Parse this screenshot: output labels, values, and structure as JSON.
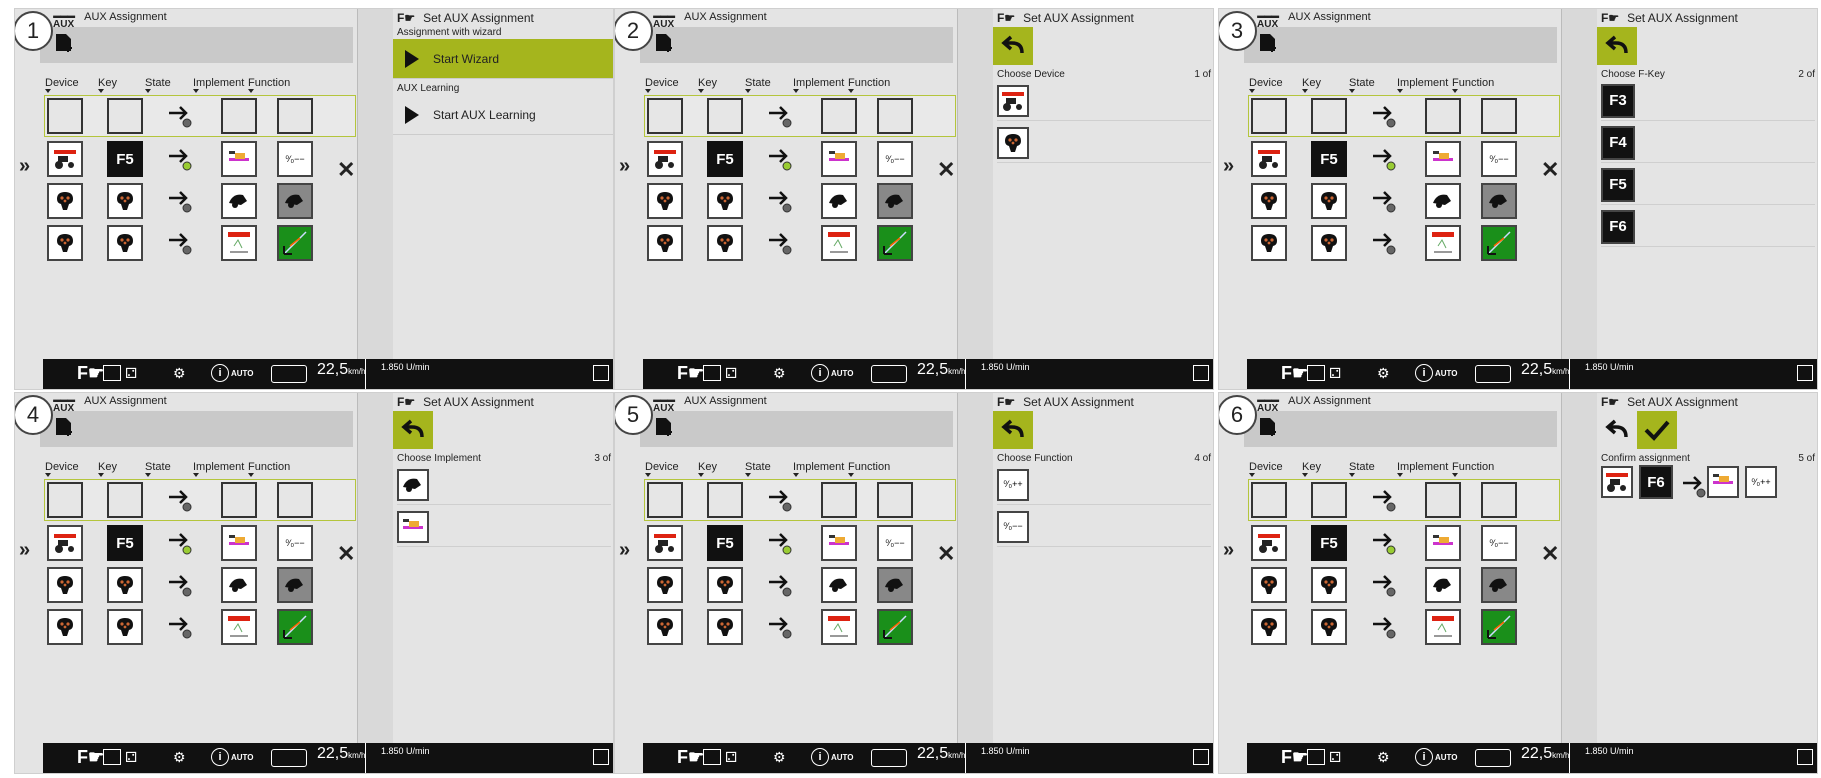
{
  "panels": [
    {
      "num": "1",
      "mode": "wizard"
    },
    {
      "num": "2",
      "mode": "device"
    },
    {
      "num": "3",
      "mode": "fkey"
    },
    {
      "num": "4",
      "mode": "implement"
    },
    {
      "num": "5",
      "mode": "function"
    },
    {
      "num": "6",
      "mode": "confirm"
    }
  ],
  "left": {
    "title": "AUX Assignment",
    "aux_logo": "AUX",
    "columns": [
      "Device",
      "Key",
      "State",
      "Implement",
      "Function"
    ],
    "row_f5": "F5"
  },
  "right": {
    "title": "Set AUX Assignment",
    "fhand_label": "F",
    "wizard_section": "Assignment with wizard",
    "start_wizard": "Start Wizard",
    "learning_section": "AUX Learning",
    "start_learning": "Start AUX Learning",
    "choose_device": "Choose Device",
    "choose_device_step": "1 of",
    "choose_fkey": "Choose F-Key",
    "choose_fkey_step": "2 of",
    "fkeys": [
      "F3",
      "F4",
      "F5",
      "F6"
    ],
    "choose_implement": "Choose Implement",
    "choose_implement_step": "3 of",
    "choose_function": "Choose Function",
    "choose_function_step": "4 of",
    "function_items": [
      "⁰⁄₀++",
      "⁰⁄₀−−"
    ],
    "confirm": "Confirm assignment",
    "confirm_step": "5 of",
    "confirm_key": "F6"
  },
  "statusbar": {
    "f_label": "F",
    "auto": "AUTO",
    "info": "i",
    "speed": "22,5",
    "speed_unit": "km/h",
    "rpm": "1.850 U/min"
  },
  "function_minus": "⁰⁄₀−−",
  "colors": {
    "accent": "#a5b51d",
    "bg": "#e4e4e4",
    "status": "#111111"
  }
}
